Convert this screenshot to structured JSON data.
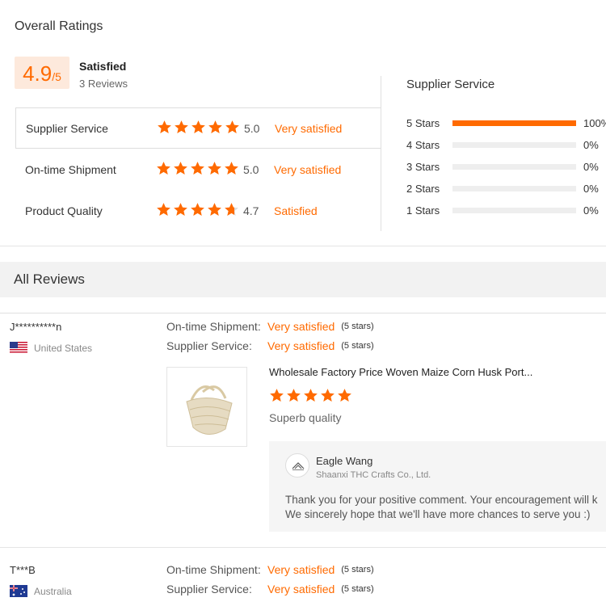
{
  "overall": {
    "title": "Overall Ratings",
    "score": "4.9",
    "score_max": "/5",
    "label": "Satisfied",
    "reviews": "3 Reviews"
  },
  "ratings": [
    {
      "label": "Supplier Service",
      "score": "5.0",
      "text": "Very satisfied",
      "stars": 5
    },
    {
      "label": "On-time Shipment",
      "score": "5.0",
      "text": "Very satisfied",
      "stars": 5
    },
    {
      "label": "Product Quality",
      "score": "4.7",
      "text": "Satisfied",
      "stars": 4.7
    }
  ],
  "breakdown": {
    "title": "Supplier Service",
    "rows": [
      {
        "label": "5  Stars",
        "pct": "100%",
        "fill": 1.0
      },
      {
        "label": "4  Stars",
        "pct": "0%",
        "fill": 0
      },
      {
        "label": "3  Stars",
        "pct": "0%",
        "fill": 0
      },
      {
        "label": "2  Stars",
        "pct": "0%",
        "fill": 0
      },
      {
        "label": "1  Stars",
        "pct": "0%",
        "fill": 0
      }
    ]
  },
  "all_reviews": {
    "title": "All Reviews",
    "items": [
      {
        "user": "J**********n",
        "country": "United States",
        "ontime_label": "On-time Shipment:",
        "ontime_value": "Very satisfied",
        "ontime_stars": "(5 stars)",
        "service_label": "Supplier Service:",
        "service_value": "Very satisfied",
        "service_stars": "(5 stars)",
        "product_title": "Wholesale Factory Price Woven Maize Corn Husk Port...",
        "product_stars": 5,
        "comment": "Superb quality",
        "reply": {
          "name": "Eagle Wang",
          "company": "Shaanxi THC Crafts Co., Ltd.",
          "line1": "Thank you for your positive comment. Your encouragement will k",
          "line2": "We sincerely hope that we'll have more chances to serve you  :)"
        }
      },
      {
        "user": "T***B",
        "country": "Australia",
        "ontime_label": "On-time Shipment:",
        "ontime_value": "Very satisfied",
        "ontime_stars": "(5 stars)",
        "service_label": "Supplier Service:",
        "service_value": "Very satisfied",
        "service_stars": "(5 stars)"
      }
    ]
  },
  "colors": {
    "accent": "#ff6a00",
    "star_empty": "#dddddd"
  }
}
